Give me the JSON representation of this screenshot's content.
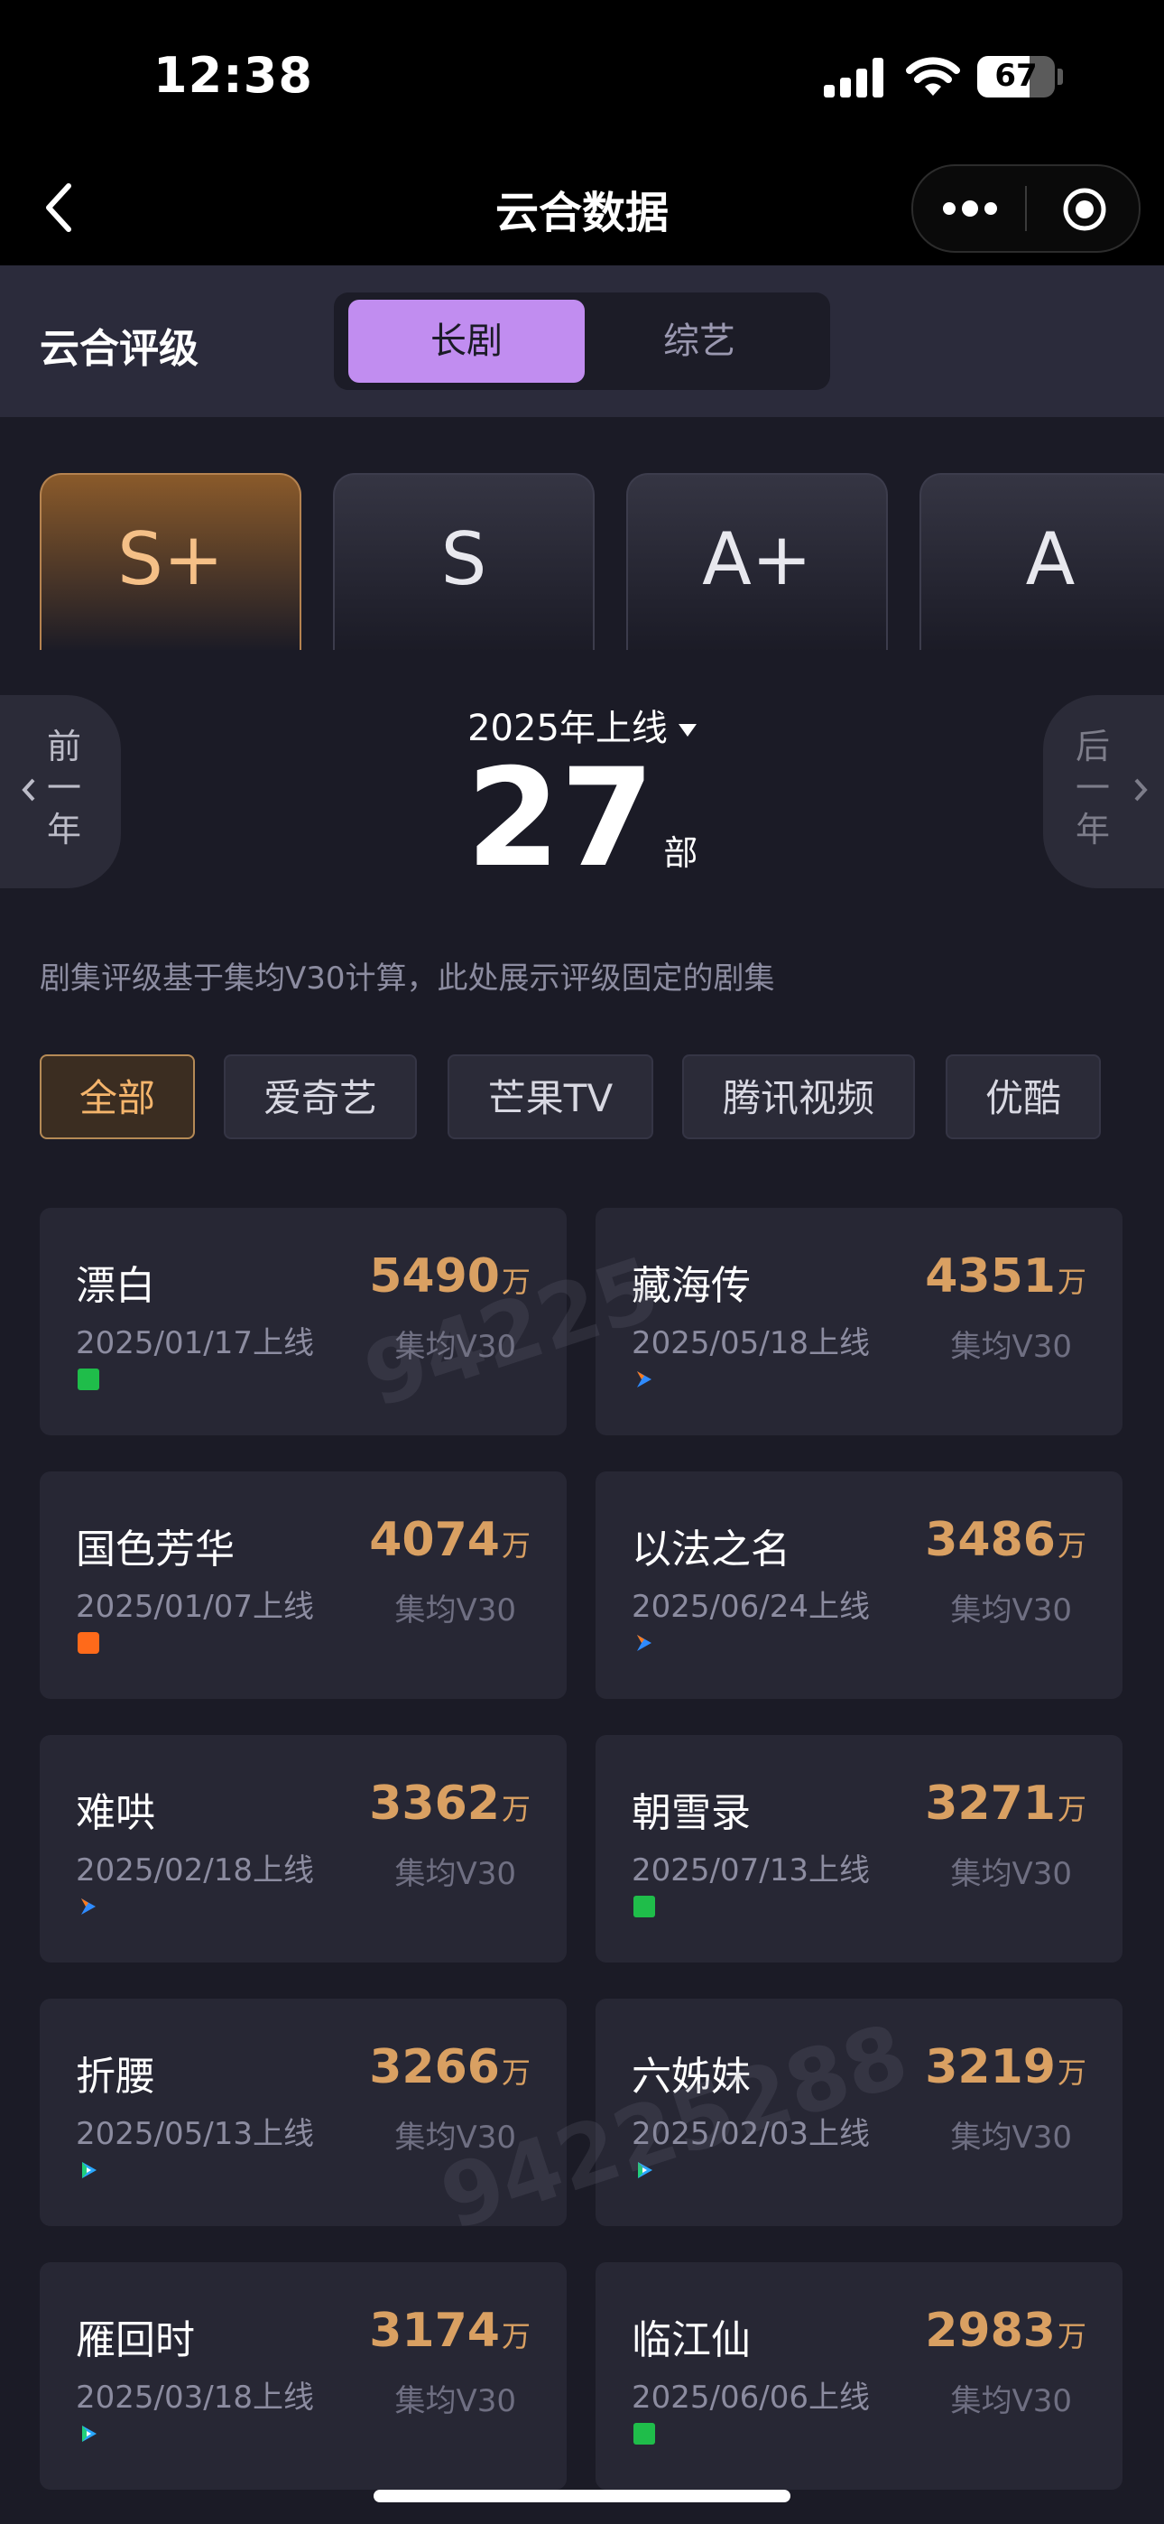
{
  "status": {
    "time": "12:38",
    "battery": "67",
    "battery_level": 0.67
  },
  "nav": {
    "title": "云合数据"
  },
  "rating": {
    "label": "云合评级",
    "tabs": [
      "长剧",
      "综艺"
    ],
    "active_tab": "长剧"
  },
  "grades": {
    "items": [
      "S+",
      "S",
      "A+",
      "A"
    ],
    "active": "S+"
  },
  "year": {
    "selected": "2025年上线",
    "prev_chars": [
      "前",
      "一",
      "年"
    ],
    "next_chars": [
      "后",
      "一",
      "年"
    ],
    "count": "27",
    "unit": "部"
  },
  "note": "剧集评级基于集均V30计算，此处展示评级固定的剧集",
  "filters": {
    "items": [
      "全部",
      "爱奇艺",
      "芒果TV",
      "腾讯视频",
      "优酷"
    ],
    "active": "全部"
  },
  "metric_label": "集均V30",
  "value_unit": "万",
  "shows": [
    {
      "title": "漂白",
      "date": "2025/01/17上线",
      "value": "5490",
      "platform": "iqiyi-icon"
    },
    {
      "title": "藏海传",
      "date": "2025/05/18上线",
      "value": "4351",
      "platform": "youku-icon"
    },
    {
      "title": "国色芳华",
      "date": "2025/01/07上线",
      "value": "4074",
      "platform": "mango-tv-icon"
    },
    {
      "title": "以法之名",
      "date": "2025/06/24上线",
      "value": "3486",
      "platform": "youku-icon"
    },
    {
      "title": "难哄",
      "date": "2025/02/18上线",
      "value": "3362",
      "platform": "youku-icon"
    },
    {
      "title": "朝雪录",
      "date": "2025/07/13上线",
      "value": "3271",
      "platform": "iqiyi-icon"
    },
    {
      "title": "折腰",
      "date": "2025/05/13上线",
      "value": "3266",
      "platform": "tencent-video-icon"
    },
    {
      "title": "六姊妹",
      "date": "2025/02/03上线",
      "value": "3219",
      "platform": "tencent-video-icon"
    },
    {
      "title": "雁回时",
      "date": "2025/03/18上线",
      "value": "3174",
      "platform": "tencent-video-icon"
    },
    {
      "title": "临江仙",
      "date": "2025/06/06上线",
      "value": "2983",
      "platform": "iqiyi-icon"
    }
  ],
  "colors": {
    "accent": "#c18df0",
    "gold": "#d9a062",
    "background": "#1b1b26",
    "card": "#272734"
  }
}
